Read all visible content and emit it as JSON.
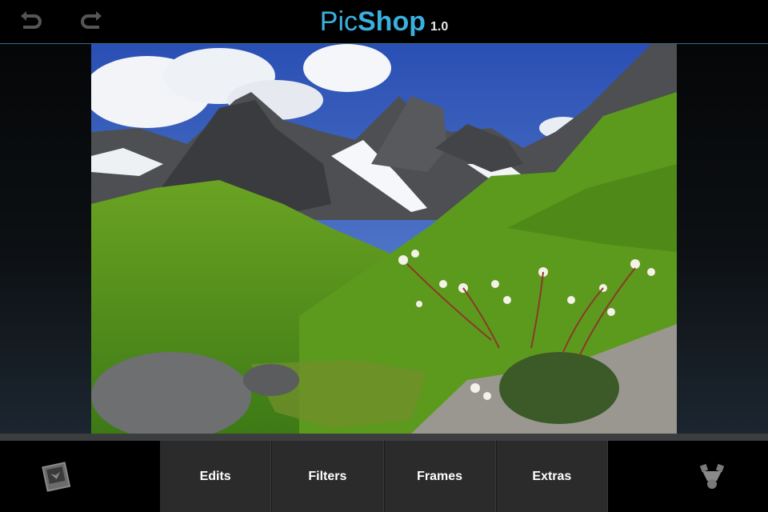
{
  "app": {
    "title_part1": "Pic",
    "title_part2": "Shop",
    "version": "1.0"
  },
  "toolbar": {
    "undo_icon": "undo-arrow-icon",
    "redo_icon": "redo-arrow-icon"
  },
  "tabs": [
    {
      "label": "Edits"
    },
    {
      "label": "Filters"
    },
    {
      "label": "Frames"
    },
    {
      "label": "Extras"
    }
  ],
  "bottom": {
    "gallery_icon": "photo-gallery-icon",
    "share_icon": "share-icon"
  },
  "colors": {
    "accent": "#3ab0df",
    "tab_bg": "#2b2b2b"
  }
}
